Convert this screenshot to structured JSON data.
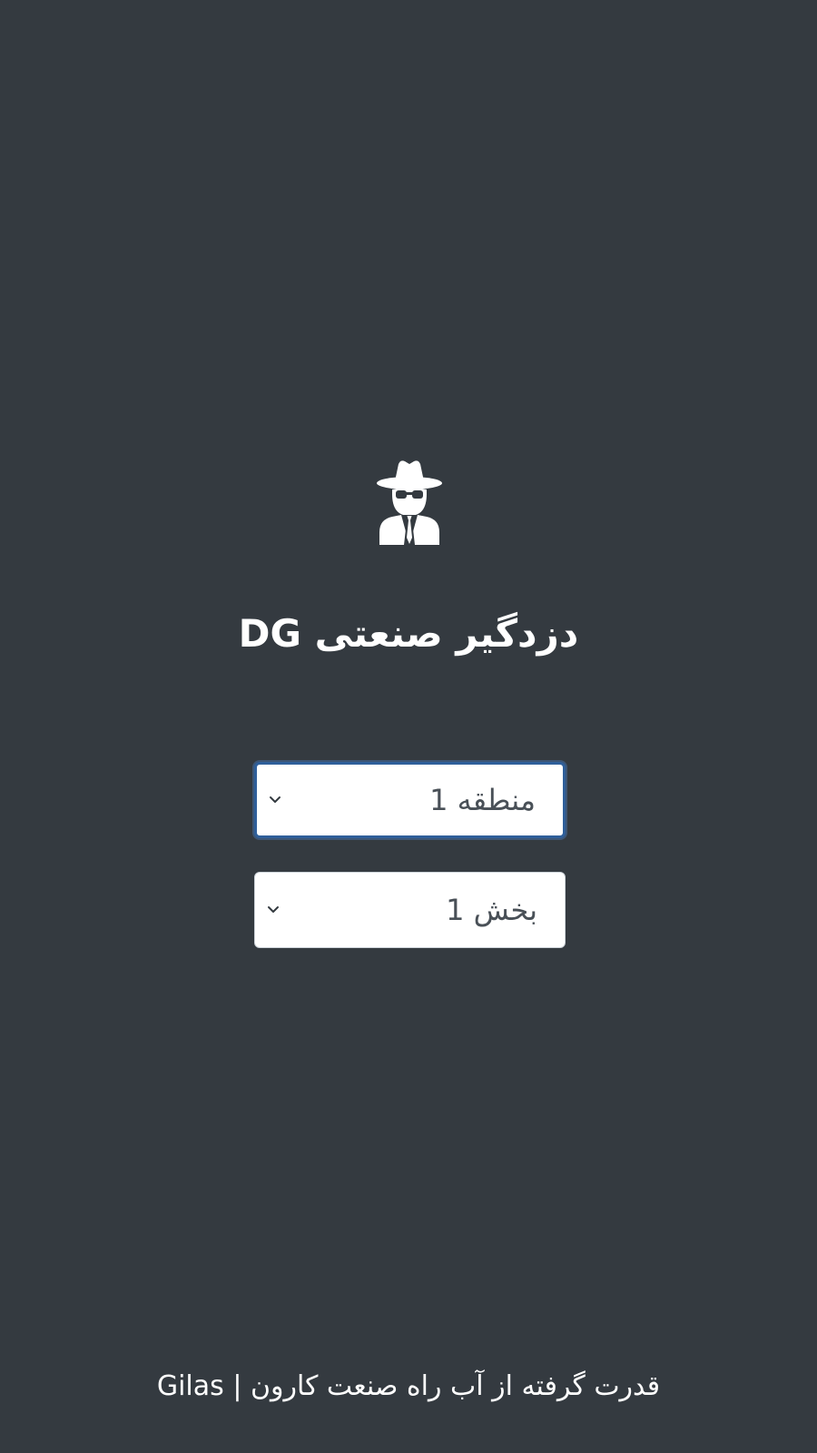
{
  "app": {
    "title": "دزدگیر صنعتی DG",
    "logo_icon": "user-secret-icon"
  },
  "form": {
    "zone_select": {
      "value": "منطقه 1",
      "icon": "chevron-down-icon"
    },
    "section_select": {
      "value": "بخش 1",
      "icon": "chevron-down-icon"
    }
  },
  "footer": {
    "text": "قدرت گرفته از آب راه صنعت کارون | Gilas"
  },
  "colors": {
    "background": "#343a40",
    "text": "#ffffff",
    "select_background": "#ffffff",
    "select_text": "#495057",
    "focus_border": "#2f5f9a"
  }
}
